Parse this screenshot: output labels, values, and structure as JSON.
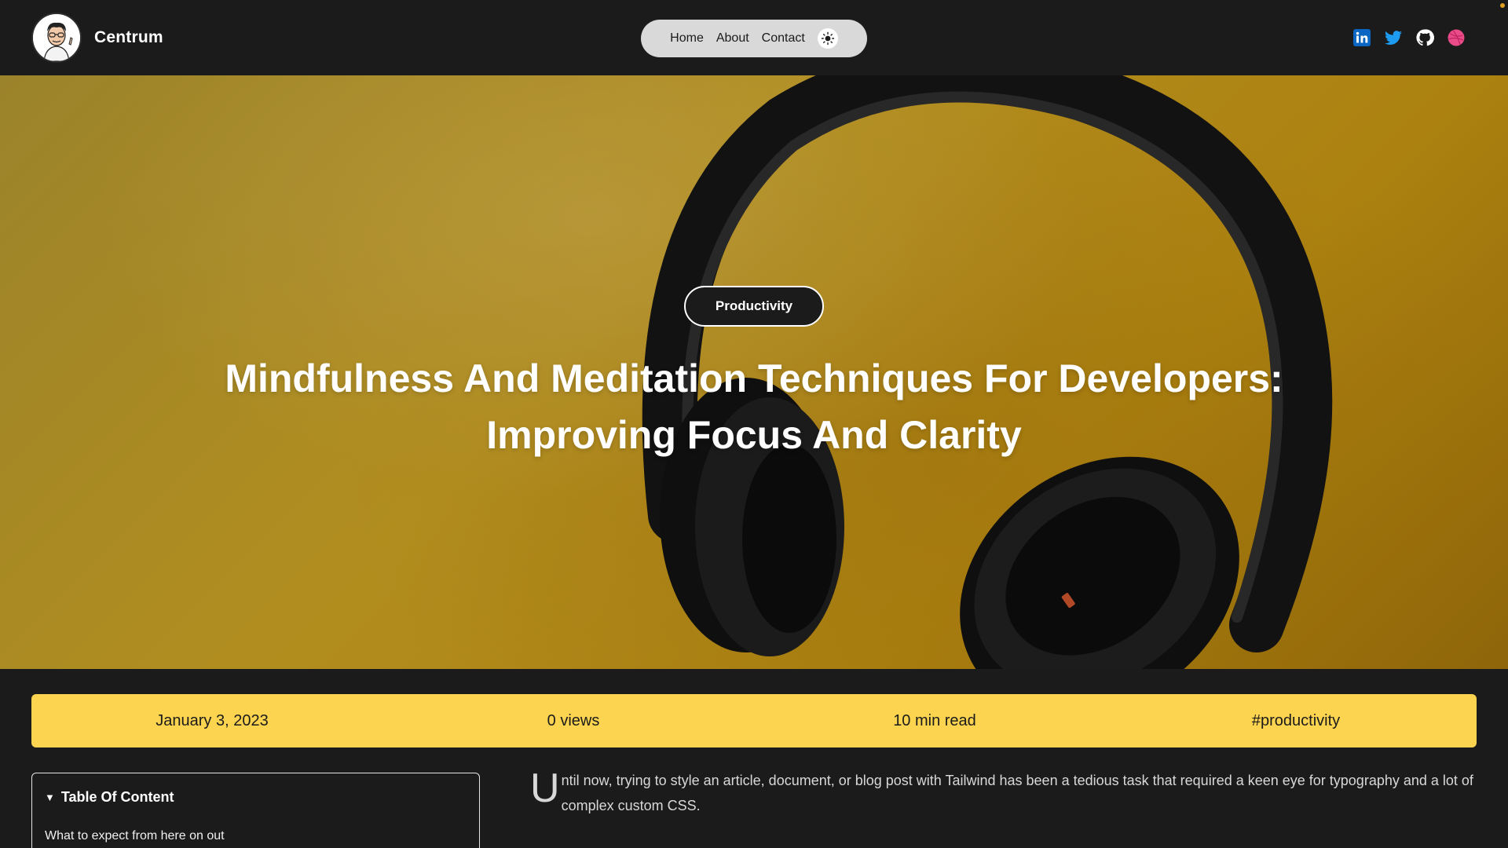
{
  "header": {
    "brand_name": "Centrum",
    "nav": {
      "home": "Home",
      "about": "About",
      "contact": "Contact"
    },
    "theme_toggle_icon": "sun-icon",
    "socials": [
      {
        "icon": "linkedin-icon",
        "color": "#0a66c2"
      },
      {
        "icon": "twitter-icon",
        "color": "#1d9bf0"
      },
      {
        "icon": "github-icon",
        "color": "#ffffff"
      },
      {
        "icon": "dribbble-icon",
        "color": "#ea4c89"
      }
    ]
  },
  "hero": {
    "category": "Productivity",
    "title": "Mindfulness And Meditation Techniques For Developers: Improving Focus And Clarity",
    "background_color": "#c19a22"
  },
  "meta": {
    "date": "January 3, 2023",
    "views": "0 views",
    "read_time": "10 min read",
    "tag": "#productivity",
    "bar_color": "#fdd44f"
  },
  "toc": {
    "title": "Table Of Content",
    "items": [
      "What to expect from here on out"
    ]
  },
  "article": {
    "drop_cap": "U",
    "first_paragraph": "ntil now, trying to style an article, document, or blog post with Tailwind has been a tedious task that required a keen eye for typography and a lot of complex custom CSS."
  }
}
